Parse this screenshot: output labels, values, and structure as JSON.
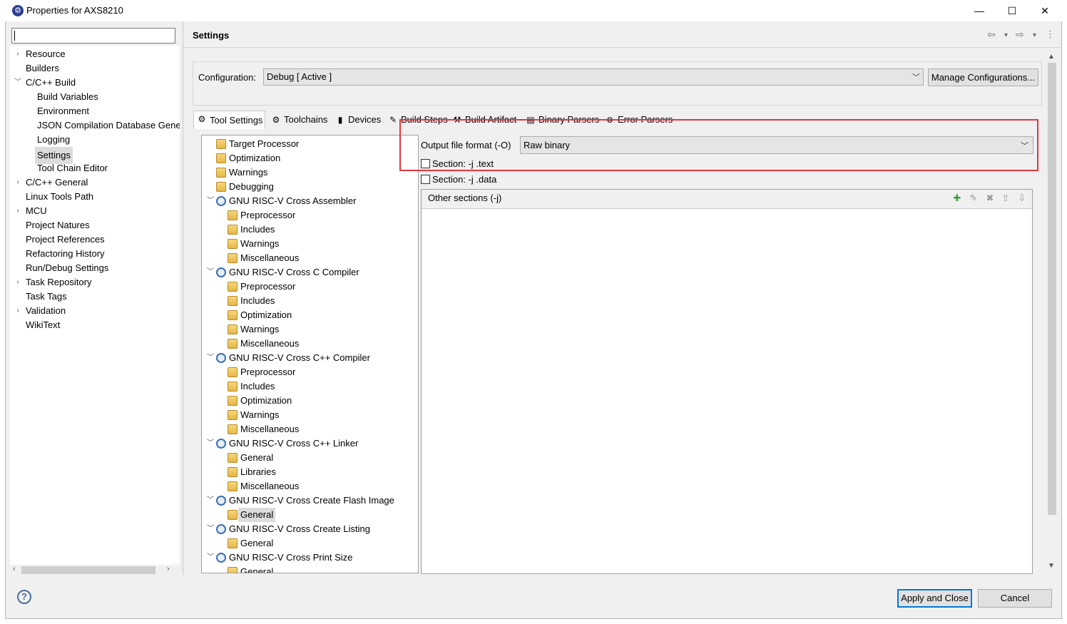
{
  "window": {
    "title": "Properties for AXS8210",
    "controls": {
      "minimize": "—",
      "maximize": "☐",
      "close": "✕"
    }
  },
  "nav": {
    "filter_value": "",
    "items": [
      {
        "label": "Resource",
        "expandable": true,
        "expanded": false,
        "level": 0
      },
      {
        "label": "Builders",
        "expandable": false,
        "level": 0
      },
      {
        "label": "C/C++ Build",
        "expandable": true,
        "expanded": true,
        "level": 0
      },
      {
        "label": "Build Variables",
        "level": 1
      },
      {
        "label": "Environment",
        "level": 1
      },
      {
        "label": "JSON Compilation Database Gene",
        "level": 1
      },
      {
        "label": "Logging",
        "level": 1
      },
      {
        "label": "Settings",
        "level": 1,
        "selected": true
      },
      {
        "label": "Tool Chain Editor",
        "level": 1
      },
      {
        "label": "C/C++ General",
        "expandable": true,
        "expanded": false,
        "level": 0
      },
      {
        "label": "Linux Tools Path",
        "level": 0
      },
      {
        "label": "MCU",
        "expandable": true,
        "expanded": false,
        "level": 0
      },
      {
        "label": "Project Natures",
        "level": 0
      },
      {
        "label": "Project References",
        "level": 0
      },
      {
        "label": "Refactoring History",
        "level": 0
      },
      {
        "label": "Run/Debug Settings",
        "level": 0
      },
      {
        "label": "Task Repository",
        "expandable": true,
        "expanded": false,
        "level": 0
      },
      {
        "label": "Task Tags",
        "level": 0
      },
      {
        "label": "Validation",
        "expandable": true,
        "expanded": false,
        "level": 0
      },
      {
        "label": "WikiText",
        "level": 0
      }
    ]
  },
  "header": {
    "title": "Settings",
    "icons": [
      "back-arrow-icon",
      "back-menu-icon",
      "forward-arrow-icon",
      "forward-menu-icon",
      "view-menu-icon"
    ]
  },
  "config": {
    "label": "Configuration:",
    "value": "Debug  [ Active ]",
    "manage_label": "Manage Configurations..."
  },
  "tabs": [
    {
      "label": "Tool Settings",
      "icon": "tool-settings-icon",
      "glyph": "⚙",
      "active": true
    },
    {
      "label": "Toolchains",
      "icon": "toolchains-icon",
      "glyph": "⚙"
    },
    {
      "label": "Devices",
      "icon": "devices-icon",
      "glyph": "▮"
    },
    {
      "label": "Build Steps",
      "icon": "build-steps-icon",
      "glyph": "✎"
    },
    {
      "label": "Build Artifact",
      "icon": "build-artifact-icon",
      "glyph": "⚒"
    },
    {
      "label": "Binary Parsers",
      "icon": "binary-parsers-icon",
      "glyph": "▤"
    },
    {
      "label": "Error Parsers",
      "icon": "error-parsers-icon",
      "glyph": "⊗"
    }
  ],
  "tool_tree": [
    {
      "label": "Target Processor",
      "level": 1,
      "kind": "folder"
    },
    {
      "label": "Optimization",
      "level": 1,
      "kind": "folder"
    },
    {
      "label": "Warnings",
      "level": 1,
      "kind": "folder"
    },
    {
      "label": "Debugging",
      "level": 1,
      "kind": "folder"
    },
    {
      "label": "GNU RISC-V Cross Assembler",
      "level": 0,
      "kind": "tool"
    },
    {
      "label": "Preprocessor",
      "level": 2,
      "kind": "folder"
    },
    {
      "label": "Includes",
      "level": 2,
      "kind": "folder"
    },
    {
      "label": "Warnings",
      "level": 2,
      "kind": "folder"
    },
    {
      "label": "Miscellaneous",
      "level": 2,
      "kind": "folder"
    },
    {
      "label": "GNU RISC-V Cross C Compiler",
      "level": 0,
      "kind": "tool"
    },
    {
      "label": "Preprocessor",
      "level": 2,
      "kind": "folder"
    },
    {
      "label": "Includes",
      "level": 2,
      "kind": "folder"
    },
    {
      "label": "Optimization",
      "level": 2,
      "kind": "folder"
    },
    {
      "label": "Warnings",
      "level": 2,
      "kind": "folder"
    },
    {
      "label": "Miscellaneous",
      "level": 2,
      "kind": "folder"
    },
    {
      "label": "GNU RISC-V Cross C++ Compiler",
      "level": 0,
      "kind": "tool"
    },
    {
      "label": "Preprocessor",
      "level": 2,
      "kind": "folder"
    },
    {
      "label": "Includes",
      "level": 2,
      "kind": "folder"
    },
    {
      "label": "Optimization",
      "level": 2,
      "kind": "folder"
    },
    {
      "label": "Warnings",
      "level": 2,
      "kind": "folder"
    },
    {
      "label": "Miscellaneous",
      "level": 2,
      "kind": "folder"
    },
    {
      "label": "GNU RISC-V Cross C++ Linker",
      "level": 0,
      "kind": "tool"
    },
    {
      "label": "General",
      "level": 2,
      "kind": "folder"
    },
    {
      "label": "Libraries",
      "level": 2,
      "kind": "folder"
    },
    {
      "label": "Miscellaneous",
      "level": 2,
      "kind": "folder"
    },
    {
      "label": "GNU RISC-V Cross Create Flash Image",
      "level": 0,
      "kind": "tool"
    },
    {
      "label": "General",
      "level": 2,
      "kind": "folder",
      "selected": true
    },
    {
      "label": "GNU RISC-V Cross Create Listing",
      "level": 0,
      "kind": "tool"
    },
    {
      "label": "General",
      "level": 2,
      "kind": "folder"
    },
    {
      "label": "GNU RISC-V Cross Print Size",
      "level": 0,
      "kind": "tool"
    },
    {
      "label": "General",
      "level": 2,
      "kind": "folder"
    }
  ],
  "settings": {
    "output_format_label": "Output file format (-O)",
    "output_format_value": "Raw binary",
    "section_text_label": "Section: -j .text",
    "section_text_checked": false,
    "section_data_label": "Section: -j .data",
    "section_data_checked": false,
    "other_sections_label": "Other sections (-j)",
    "other_sections_icons": [
      "add-icon",
      "edit-icon",
      "delete-icon",
      "move-up-icon",
      "move-down-icon"
    ],
    "highlight_color": "#e0393e"
  },
  "footer": {
    "help_label": "?",
    "apply_label": "Apply and Close",
    "cancel_label": "Cancel"
  }
}
